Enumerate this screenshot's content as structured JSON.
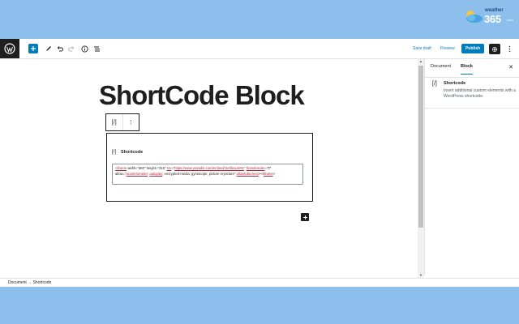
{
  "brand": {
    "word": "weather",
    "number": "365",
    "suffix": ".com"
  },
  "toolbar": {
    "save_draft": "Save draft",
    "preview": "Preview",
    "publish": "Publish"
  },
  "editor": {
    "title": "ShortCode Block",
    "block_toolbar_icon": "[/]",
    "block_toolbar_more": "⋮",
    "shortcode_icon": "[/]",
    "shortcode_label": "Shortcode",
    "shortcode_value_parts": {
      "p1": "<iframe",
      "p2": " width=\"560\" height=\"315\" ",
      "p3": "src",
      "p4": "=\"",
      "p5": "https://www.youtube.com/embed/rJe0baLnIKE",
      "p6": "\" ",
      "p7": "frameborder",
      "p8": "=\"0\" allow=\"",
      "p9": "accelerometer",
      "p10": "; ",
      "p11": "autoplay",
      "p12": "; encrypted-media; gyroscope; picture-in-picture\" ",
      "p13": "allowfullscreen",
      "p14": "></",
      "p15": "iframe",
      "p16": ">"
    }
  },
  "sidebar": {
    "tab_document": "Document",
    "tab_block": "Block",
    "close": "✕",
    "block_icon": "[/]",
    "block_name": "Shortcode",
    "block_description": "Insert additional custom elements with a WordPress shortcode."
  },
  "footer": {
    "breadcrumb_document": "Document",
    "breadcrumb_sep": "→",
    "breadcrumb_current": "Shortcode"
  },
  "colors": {
    "accent": "#007cba",
    "dark": "#1e1e1e",
    "background": "#8dbfec"
  }
}
